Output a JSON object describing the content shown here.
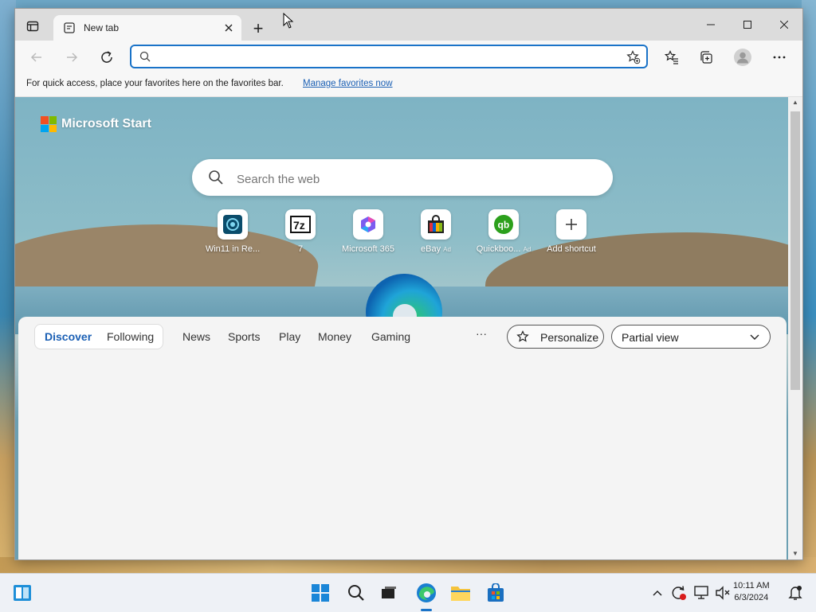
{
  "browser": {
    "tab": {
      "title": "New tab"
    },
    "address_bar": {
      "value": "",
      "placeholder": ""
    },
    "favorites_bar": {
      "message": "For quick access, place your favorites here on the favorites bar.",
      "link": "Manage favorites now"
    },
    "window_controls": {
      "minimize": "—",
      "maximize": "☐",
      "close": "✕"
    },
    "new_tab_symbol": "+"
  },
  "newtab_page": {
    "brand": "Microsoft Start",
    "search_placeholder": "Search the web",
    "shortcuts": [
      {
        "label": "Win11 in Re...",
        "icon": "win11-icon"
      },
      {
        "label": "7",
        "icon": "7zip-icon"
      },
      {
        "label": "Microsoft 365",
        "icon": "m365-icon"
      },
      {
        "label": "eBay",
        "badge": "Ad",
        "icon": "ebay-bag-icon"
      },
      {
        "label": "Quickboo...",
        "badge": "Ad",
        "icon": "quickbooks-icon"
      },
      {
        "label": "Add shortcut",
        "icon": "plus-icon"
      }
    ],
    "feed_tabs": {
      "discover": "Discover",
      "following": "Following",
      "news": "News",
      "sports": "Sports",
      "play": "Play",
      "money": "Money",
      "gaming": "Gaming",
      "more": "···"
    },
    "personalize": "Personalize",
    "view_select": "Partial view"
  },
  "taskbar": {
    "time": "10:11 AM",
    "date": "6/3/2024"
  },
  "colors": {
    "accent": "#1a73c8",
    "link": "#1a5fb4",
    "ms_red": "#f25022",
    "ms_green": "#7fba00",
    "ms_blue": "#00a4ef",
    "ms_yellow": "#ffb900"
  }
}
